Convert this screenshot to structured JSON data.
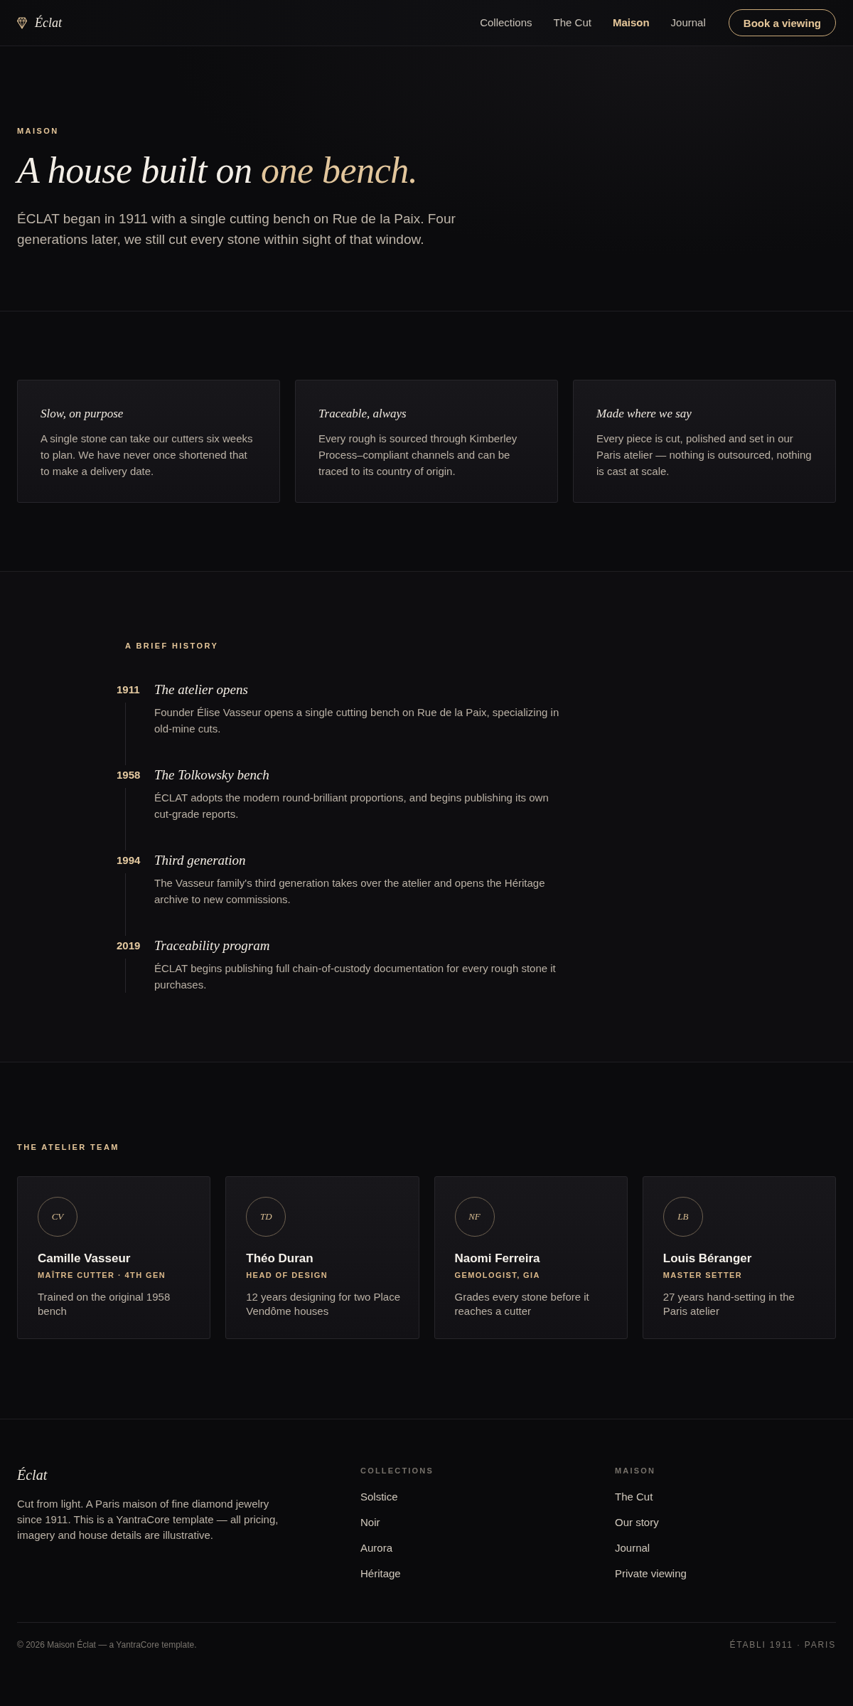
{
  "header": {
    "brand": "Éclat",
    "nav": [
      {
        "label": "Collections",
        "selected": false
      },
      {
        "label": "The Cut",
        "selected": false
      },
      {
        "label": "Maison",
        "selected": true
      },
      {
        "label": "Journal",
        "selected": false
      }
    ],
    "cta": "Book a viewing"
  },
  "hero": {
    "eyebrow": "MAISON",
    "title": "A house built on",
    "title_accent": "one bench.",
    "lead": "ÉCLAT began in 1911 with a single cutting bench on Rue de la Paix. Four generations later, we still cut every stone within sight of that window."
  },
  "values": [
    {
      "title": "Slow, on purpose",
      "text": "A single stone can take our cutters six weeks to plan. We have never once shortened that to make a delivery date."
    },
    {
      "title": "Traceable, always",
      "text": "Every rough is sourced through Kimberley Process–compliant channels and can be traced to its country of origin."
    },
    {
      "title": "Made where we say",
      "text": "Every piece is cut, polished and set in our Paris atelier — nothing is outsourced, nothing is cast at scale."
    }
  ],
  "history": {
    "label": "A BRIEF HISTORY",
    "events": [
      {
        "year": "1911",
        "title": "The atelier opens",
        "text": "Founder Élise Vasseur opens a single cutting bench on Rue de la Paix, specializing in old-mine cuts."
      },
      {
        "year": "1958",
        "title": "The Tolkowsky bench",
        "text": "ÉCLAT adopts the modern round-brilliant proportions, and begins publishing its own cut-grade reports."
      },
      {
        "year": "1994",
        "title": "Third generation",
        "text": "The Vasseur family's third generation takes over the atelier and opens the Héritage archive to new commissions."
      },
      {
        "year": "2019",
        "title": "Traceability program",
        "text": "ÉCLAT begins publishing full chain-of-custody documentation for every rough stone it purchases."
      }
    ]
  },
  "team": {
    "label": "THE ATELIER TEAM",
    "members": [
      {
        "initials": "CV",
        "name": "Camille Vasseur",
        "role": "MAÎTRE CUTTER · 4TH GEN",
        "bio": "Trained on the original 1958 bench"
      },
      {
        "initials": "TD",
        "name": "Théo Duran",
        "role": "HEAD OF DESIGN",
        "bio": "12 years designing for two Place Vendôme houses"
      },
      {
        "initials": "NF",
        "name": "Naomi Ferreira",
        "role": "GEMOLOGIST, GIA",
        "bio": "Grades every stone before it reaches a cutter"
      },
      {
        "initials": "LB",
        "name": "Louis Béranger",
        "role": "MASTER SETTER",
        "bio": "27 years hand-setting in the Paris atelier"
      }
    ]
  },
  "footer": {
    "brand": "Éclat",
    "blurb": "Cut from light. A Paris maison of fine diamond jewelry since 1911. This is a YantraCore template — all pricing, imagery and house details are illustrative.",
    "columns": [
      {
        "heading": "COLLECTIONS",
        "links": [
          "Solstice",
          "Noir",
          "Aurora",
          "Héritage"
        ]
      },
      {
        "heading": "MAISON",
        "links": [
          "The Cut",
          "Our story",
          "Journal",
          "Private viewing"
        ]
      }
    ],
    "copyright": "© 2026 Maison Éclat — a YantraCore template.",
    "tagline": "ÉTABLI 1911 · PARIS"
  }
}
